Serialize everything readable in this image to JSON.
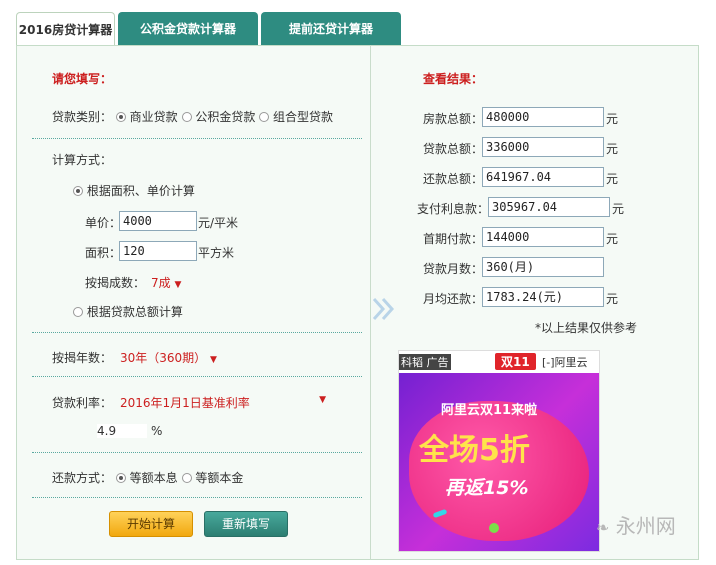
{
  "tabs": [
    {
      "label": "2016房贷计算器"
    },
    {
      "label": "公积金贷款计算器"
    },
    {
      "label": "提前还贷计算器"
    }
  ],
  "left": {
    "heading": "请您填写：",
    "loan_type_label": "贷款类别：",
    "loan_types": [
      "商业贷款",
      "公积金贷款",
      "组合型贷款"
    ],
    "calc_method_label": "计算方式：",
    "method_area": "根据面积、单价计算",
    "unit_price_label": "单价：",
    "unit_price_value": "4000",
    "unit_price_unit": "元/平米",
    "area_label": "面积：",
    "area_value": "120",
    "area_unit": "平方米",
    "mortgage_ratio_label": "按揭成数：",
    "mortgage_ratio_value": "7成",
    "method_total": "根据贷款总额计算",
    "years_label": "按揭年数：",
    "years_value": "30年（360期）",
    "rate_label": "贷款利率：",
    "rate_value": "2016年1月1日基准利率",
    "rate_number": "4.9",
    "rate_unit": "%",
    "repay_label": "还款方式：",
    "repay_options": [
      "等额本息",
      "等额本金"
    ],
    "btn_calc": "开始计算",
    "btn_reset": "重新填写"
  },
  "right": {
    "heading": "查看结果：",
    "rows": [
      {
        "label": "房款总额：",
        "value": "480000",
        "unit": "元"
      },
      {
        "label": "贷款总额：",
        "value": "336000",
        "unit": "元"
      },
      {
        "label": "还款总额：",
        "value": "641967.04",
        "unit": "元"
      },
      {
        "label": "支付利息款：",
        "value": "305967.04",
        "unit": "元"
      },
      {
        "label": "首期付款：",
        "value": "144000",
        "unit": "元"
      },
      {
        "label": "贷款月数：",
        "value": "360(月)",
        "unit": ""
      },
      {
        "label": "月均还款：",
        "value": "1783.24(元)",
        "unit": "元"
      }
    ],
    "note": "*以上结果仅供参考"
  },
  "ad": {
    "corner_label": "科韬 广告",
    "badge": "双11",
    "brand": "阿里云",
    "line1": "阿里云双11来啦",
    "line2": "全场5折",
    "line3": "再返15%"
  },
  "watermark": "永州网"
}
